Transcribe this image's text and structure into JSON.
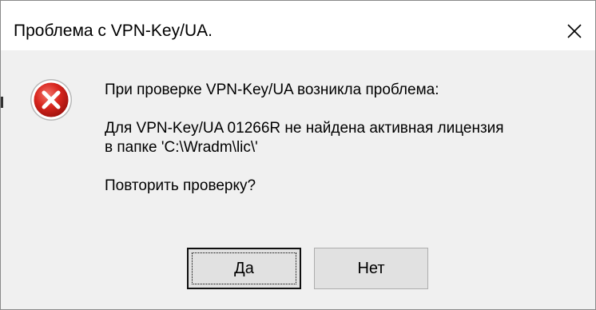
{
  "window": {
    "title": "Проблема с VPN-Key/UA."
  },
  "icons": {
    "error": "error-icon",
    "close": "close-icon"
  },
  "message": {
    "line1": "При проверке VPN-Key/UA возникла проблема:",
    "line2": "Для VPN-Key/UA 01266R не найдена активная лицензия",
    "line3": "в папке 'C:\\Wradm\\lic\\'",
    "question": "Повторить проверку?"
  },
  "buttons": {
    "yes_label": "Да",
    "no_label": "Нет"
  },
  "colors": {
    "dialog_bg": "#f0f0f0",
    "title_bg": "#ffffff",
    "error_red": "#d0211b",
    "button_bg": "#e1e1e1"
  }
}
